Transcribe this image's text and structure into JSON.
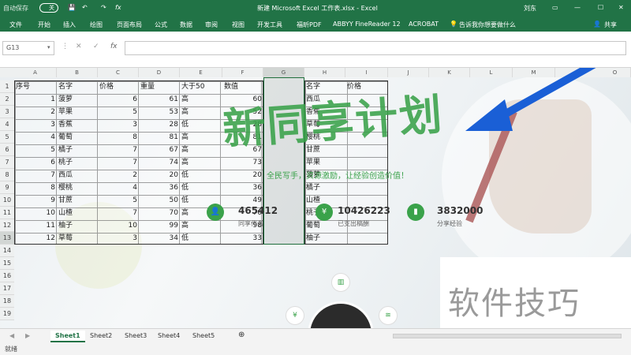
{
  "titlebar": {
    "autosave": "自动保存",
    "autosave_state": "关",
    "title": "新建 Microsoft Excel 工作表.xlsx  -  Excel",
    "user": "刘东"
  },
  "ribbon": {
    "tabs": [
      "文件",
      "开始",
      "插入",
      "绘图",
      "页面布局",
      "公式",
      "数据",
      "审阅",
      "视图",
      "开发工具",
      "福昕PDF",
      "ABBYY FineReader 12",
      "ACROBAT"
    ],
    "tell_me": "告诉我你想要做什么",
    "share": "共享"
  },
  "formula_bar": {
    "name_box": "G13",
    "fx": "fx",
    "formula": ""
  },
  "columns": [
    "A",
    "B",
    "C",
    "D",
    "E",
    "F",
    "G",
    "H",
    "I",
    "J",
    "K",
    "L",
    "M",
    "O"
  ],
  "rows": [
    "1",
    "2",
    "3",
    "4",
    "5",
    "6",
    "7",
    "8",
    "9",
    "10",
    "11",
    "12",
    "13",
    "14",
    "15",
    "16",
    "17",
    "18",
    "19"
  ],
  "table1": {
    "headers": [
      "序号",
      "名字",
      "价格",
      "重量",
      "大于50",
      "数值"
    ],
    "rows": [
      [
        "1",
        "菠萝",
        "6",
        "61",
        "高",
        "60"
      ],
      [
        "2",
        "苹果",
        "5",
        "53",
        "高",
        "52"
      ],
      [
        "3",
        "香蕉",
        "3",
        "28",
        "低",
        "28"
      ],
      [
        "4",
        "葡萄",
        "8",
        "81",
        "高",
        "81"
      ],
      [
        "5",
        "橘子",
        "7",
        "67",
        "高",
        "67"
      ],
      [
        "6",
        "桃子",
        "7",
        "74",
        "高",
        "73"
      ],
      [
        "7",
        "西瓜",
        "2",
        "20",
        "低",
        "20"
      ],
      [
        "8",
        "樱桃",
        "4",
        "36",
        "低",
        "36"
      ],
      [
        "9",
        "甘蔗",
        "5",
        "50",
        "低",
        "49"
      ],
      [
        "10",
        "山楂",
        "7",
        "70",
        "高",
        "70"
      ],
      [
        "11",
        "柚子",
        "10",
        "99",
        "高",
        "98"
      ],
      [
        "12",
        "草莓",
        "3",
        "34",
        "低",
        "33"
      ]
    ]
  },
  "table2": {
    "headers": [
      "名字",
      "价格"
    ],
    "items": [
      "西瓜",
      "香蕉",
      "草莓",
      "樱桃",
      "甘蔗",
      "苹果",
      "菠萝",
      "橘子",
      "山楂",
      "桃子",
      "葡萄",
      "柚子"
    ]
  },
  "overlay": {
    "banner": "新同享计划",
    "slogan": "全民写手，资源激励，让经验创造价值！",
    "stats": [
      {
        "value": "465412",
        "label": "同享作者"
      },
      {
        "value": "10426223",
        "label": "已支出稿酬"
      },
      {
        "value": "3832000",
        "label": "分享经验"
      }
    ],
    "watermark": "软件技巧"
  },
  "sheets": [
    "Sheet1",
    "Sheet2",
    "Sheet3",
    "Sheet4",
    "Sheet5"
  ],
  "status": {
    "text": "就绪"
  },
  "colors": {
    "excel_green": "#217346",
    "banner_green": "#3aa24a",
    "arrow_blue": "#1a5fd6"
  }
}
